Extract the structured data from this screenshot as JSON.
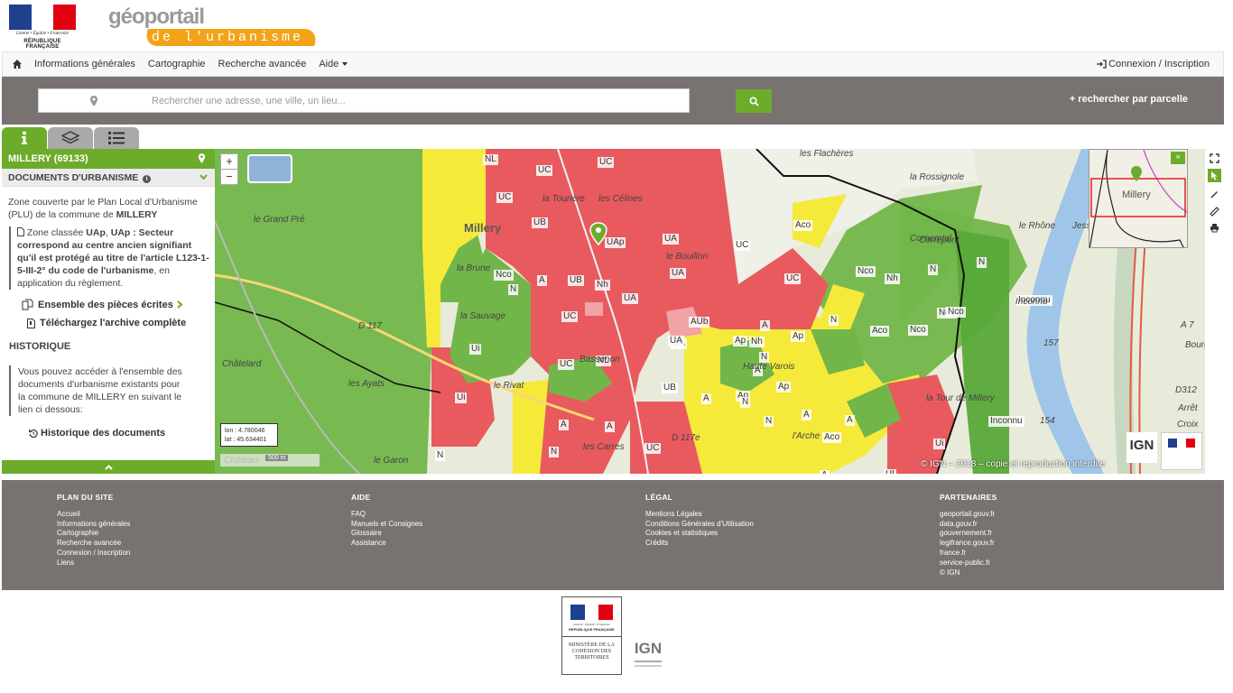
{
  "header": {
    "rf_motto": "Liberté • Égalité • Fraternité",
    "rf_name": "RÉPUBLIQUE FRANÇAISE",
    "logo_geo": "géoportail",
    "logo_band": "de l'urbanisme"
  },
  "navbar": {
    "items": [
      "Informations générales",
      "Cartographie",
      "Recherche avancée",
      "Aide"
    ],
    "login": "Connexion / Inscription"
  },
  "search": {
    "placeholder": "Rechercher une adresse, une ville, un lieu...",
    "parcel_link": "+ rechercher par parcelle"
  },
  "sidepanel": {
    "commune": "MILLERY (69133)",
    "docs_title": "DOCUMENTS D'URBANISME",
    "zone_intro_1": "Zone couverte par le Plan Local d'Urbanisme (PLU) de la commune de ",
    "zone_intro_commune": "MILLERY",
    "zone_prefix": "Zone classée ",
    "zone_code": "UAp",
    "zone_desc": "UAp : Secteur correspond au centre ancien signifiant qu'il est protégé au titre de l'article L123-1-5-III-2° du code de l'urbanisme",
    "zone_suffix": ", en application du règlement.",
    "link_pieces": "Ensemble des pièces écrites",
    "link_archive": "Téléchargez l'archive complète",
    "history_title": "HISTORIQUE",
    "history_text": "Vous pouvez accéder à l'ensemble des documents d'urbanisme existants pour la commune de MILLERY en suivant le lien ci dessous:",
    "history_link": "Historique des documents"
  },
  "map": {
    "coords_lon": "lon : 4.780046",
    "coords_lat": "lat : 45.634401",
    "scale": "500 m",
    "copyright": "© IGN – 2018 – copie et reproduction interdite",
    "ign": "IGN",
    "overview_label": "Millery",
    "zones": [
      {
        "t": "NL"
      },
      {
        "t": "UC"
      },
      {
        "t": "UC"
      },
      {
        "t": "UC"
      },
      {
        "t": "UB"
      },
      {
        "t": "UAp"
      },
      {
        "t": "UA"
      },
      {
        "t": "UA"
      },
      {
        "t": "UC"
      },
      {
        "t": "Aco"
      },
      {
        "t": "A"
      },
      {
        "t": "N"
      },
      {
        "t": "Nco"
      },
      {
        "t": "Nh"
      },
      {
        "t": "Nco"
      },
      {
        "t": "Nh"
      },
      {
        "t": "N"
      },
      {
        "t": "N"
      },
      {
        "t": "UC"
      },
      {
        "t": "Inconnu"
      },
      {
        "t": "UB"
      },
      {
        "t": "UA"
      },
      {
        "t": "UA"
      },
      {
        "t": "UC"
      },
      {
        "t": "AUb"
      },
      {
        "t": "UA"
      },
      {
        "t": "A"
      },
      {
        "t": "Ap"
      },
      {
        "t": "Ap"
      },
      {
        "t": "Aco"
      },
      {
        "t": "N"
      },
      {
        "t": "Nco"
      },
      {
        "t": "A"
      },
      {
        "t": "Nh"
      },
      {
        "t": "N"
      },
      {
        "t": "Ui"
      },
      {
        "t": "UC"
      },
      {
        "t": "NL"
      },
      {
        "t": "Ui"
      },
      {
        "t": "UB"
      },
      {
        "t": "Ap"
      },
      {
        "t": "Ap"
      },
      {
        "t": "A"
      },
      {
        "t": "N"
      },
      {
        "t": "A"
      },
      {
        "t": "N"
      },
      {
        "t": "UC"
      },
      {
        "t": "Aco"
      },
      {
        "t": "N"
      },
      {
        "t": "Inconnu"
      },
      {
        "t": "UI"
      },
      {
        "t": "A"
      },
      {
        "t": "Nco"
      },
      {
        "t": "A"
      },
      {
        "t": "A"
      },
      {
        "t": "N"
      },
      {
        "t": "Ui"
      },
      {
        "t": "Nco"
      },
      {
        "t": "A"
      }
    ],
    "places": [
      "les Flachères",
      "la Rossignole",
      "Millery",
      "le Grand Pré",
      "Châtelard",
      "les Ayats",
      "le Garon",
      "Château",
      "le Rhône",
      "Jessy",
      "Inconnu",
      "157",
      "154",
      "Arrêt",
      "Croix",
      "D 117",
      "le Rivat",
      "la Brune",
      "la Sauvage",
      "le Bouillon",
      "Bassenon",
      "Haute Varois",
      "l'Arche",
      "les Carres",
      "la Tour de Millery",
      "Cornemtal",
      "Correpont",
      "A 7",
      "D312",
      "Bourg",
      "D 117e",
      "les Célines",
      "la Tourière"
    ]
  },
  "footer": {
    "cols": [
      {
        "title": "PLAN DU SITE",
        "links": [
          "Accueil",
          "Informations générales",
          "Cartographie",
          "Recherche avancée",
          "Connexion / Inscription",
          "Liens"
        ]
      },
      {
        "title": "AIDE",
        "links": [
          "FAQ",
          "Manuels et Consignes",
          "Glossaire",
          "Assistance"
        ]
      },
      {
        "title": "LÉGAL",
        "links": [
          "Mentions Légales",
          "Conditions Générales d'Utilisation",
          "Cookies et statistiques",
          "Crédits"
        ]
      },
      {
        "title": "PARTENAIRES",
        "links": [
          "geoportail.gouv.fr",
          "data.gouv.fr",
          "gouvernement.fr",
          "legifrance.gouv.fr",
          "france.fr",
          "service-public.fr",
          "© IGN"
        ]
      }
    ],
    "ministry_motto": "Liberté • Égalité • Fraternité",
    "ministry_rf": "RÉPUBLIQUE FRANÇAISE",
    "ministry_name": "MINISTÈRE DE LA COHÉSION DES TERRITOIRES",
    "ign_bottom": "IGN"
  },
  "colors": {
    "green": "#6cac2a",
    "grey": "#787370",
    "zone_red": "#e85a5e",
    "zone_green": "#72b64a",
    "zone_yellow": "#f5ea3a"
  }
}
